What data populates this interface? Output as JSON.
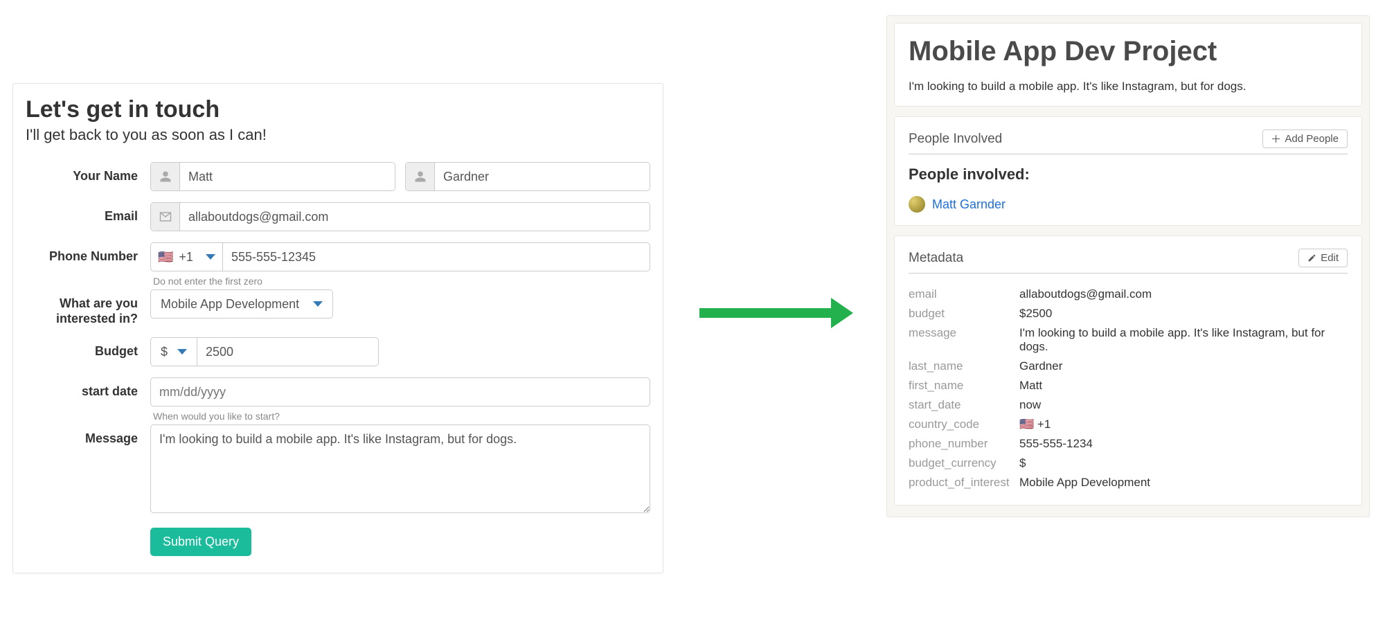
{
  "form": {
    "title": "Let's get in touch",
    "subtitle": "I'll get back to you as soon as I can!",
    "labels": {
      "your_name": "Your Name",
      "email": "Email",
      "phone": "Phone Number",
      "interest": "What are you interested in?",
      "budget": "Budget",
      "start_date": "start date",
      "message": "Message"
    },
    "values": {
      "first_name": "Matt",
      "last_name": "Gardner",
      "email": "allaboutdogs@gmail.com",
      "country_code": "+1",
      "country_flag": "🇺🇸",
      "phone": "555-555-12345",
      "interest": "Mobile App Development",
      "currency": "$",
      "budget": "2500",
      "start_date": "",
      "message": "I'm looking to build a mobile app. It's like Instagram, but for dogs."
    },
    "placeholders": {
      "start_date": "mm/dd/yyyy"
    },
    "help": {
      "phone": "Do not enter the first zero",
      "start_date": "When would you like to start?"
    },
    "submit_label": "Submit Query"
  },
  "project": {
    "title": "Mobile App Dev Project",
    "description": "I'm looking to build a mobile app. It's like Instagram, but for dogs.",
    "people": {
      "section_label": "People Involved",
      "add_button": "Add People",
      "heading": "People involved:",
      "list": [
        {
          "name": "Matt Garnder"
        }
      ]
    },
    "metadata": {
      "section_label": "Metadata",
      "edit_button": "Edit",
      "rows": [
        {
          "key": "email",
          "value": "allaboutdogs@gmail.com"
        },
        {
          "key": "budget",
          "value": "$2500"
        },
        {
          "key": "message",
          "value": "I'm looking to build a mobile app. It's like Instagram, but for dogs."
        },
        {
          "key": "last_name",
          "value": "Gardner"
        },
        {
          "key": "first_name",
          "value": "Matt"
        },
        {
          "key": "start_date",
          "value": "now"
        },
        {
          "key": "country_code",
          "value": "🇺🇸 +1"
        },
        {
          "key": "phone_number",
          "value": "555-555-1234"
        },
        {
          "key": "budget_currency",
          "value": "$"
        },
        {
          "key": "product_of_interest",
          "value": "Mobile App Development"
        }
      ]
    }
  }
}
